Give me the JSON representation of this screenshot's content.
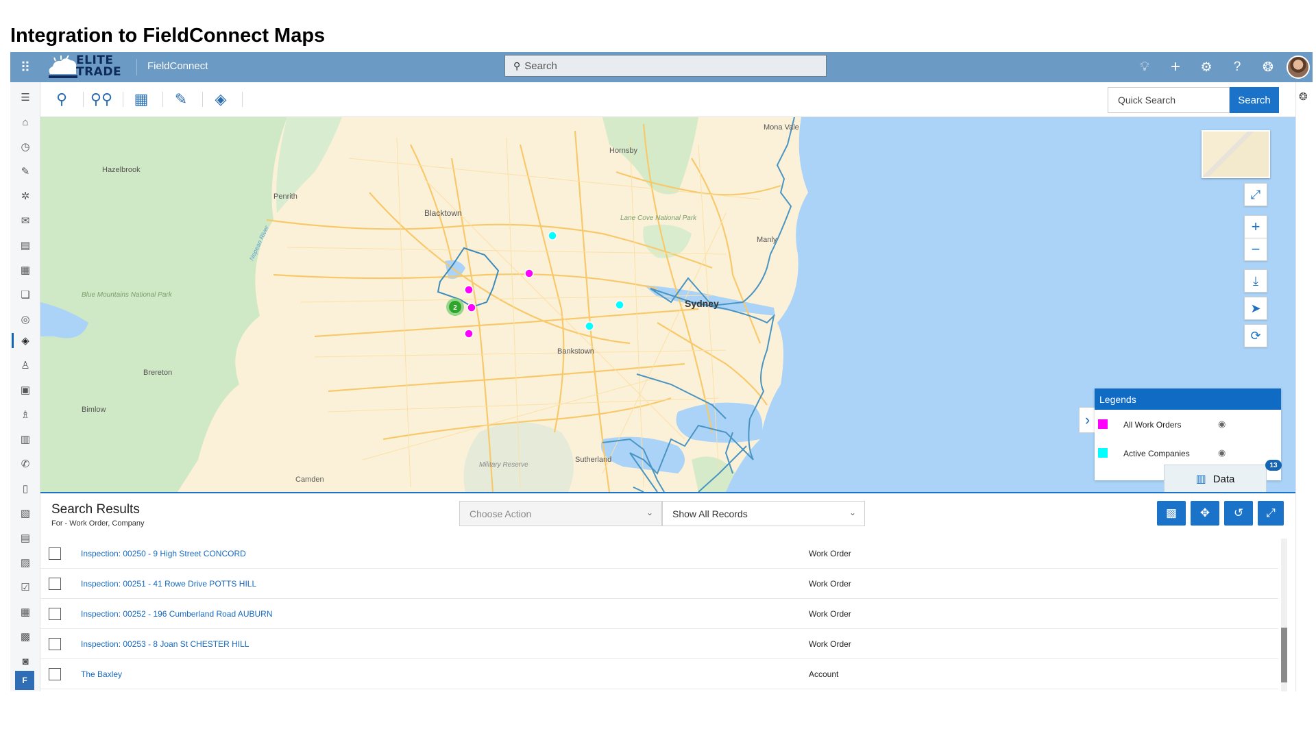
{
  "page_heading": "Integration to FieldConnect Maps",
  "topbar": {
    "brand_line1": "ELITE",
    "brand_line2": "TRADE",
    "app_name": "FieldConnect",
    "search_placeholder": "Search",
    "icons": [
      "app-launcher-icon",
      "lightbulb-icon",
      "plus-icon",
      "gear-icon",
      "help-icon",
      "copilot-icon"
    ]
  },
  "toolbar": {
    "tools": [
      "search-icon",
      "route-pins-icon",
      "calendar-icon",
      "ruler-icon",
      "layers-icon"
    ],
    "quick_search_placeholder": "Quick Search",
    "search_button": "Search"
  },
  "map": {
    "place_labels": [
      "Hazelbrook",
      "Penrith",
      "Blacktown",
      "Hornsby",
      "Mona Vale",
      "Lane Cove National Park",
      "Manly",
      "Sydney",
      "Bankstown",
      "Brereton",
      "Bimlow",
      "Blue Mountains National Park",
      "Camden",
      "Sutherland",
      "Military Reserve",
      "Nepean River"
    ],
    "cluster_count": "2",
    "legend": {
      "title": "Legends",
      "items": [
        {
          "label": "All Work Orders",
          "color": "#ff00ff"
        },
        {
          "label": "Active Companies",
          "color": "#00ffff"
        }
      ]
    },
    "data_button": "Data",
    "data_count": "13"
  },
  "results": {
    "title": "Search Results",
    "subtitle": "For - Work Order, Company",
    "action_placeholder": "Choose Action",
    "filter_value": "Show All Records",
    "rows": [
      {
        "name": "Inspection: 00250 - 9 High Street CONCORD",
        "type": "Work Order"
      },
      {
        "name": "Inspection: 00251 - 41 Rowe Drive POTTS HILL",
        "type": "Work Order"
      },
      {
        "name": "Inspection: 00252 - 196 Cumberland Road AUBURN",
        "type": "Work Order"
      },
      {
        "name": "Inspection: 00253 - 8 Joan St CHESTER HILL",
        "type": "Work Order"
      },
      {
        "name": "The Baxley",
        "type": "Account"
      }
    ]
  },
  "user_initial": "F",
  "colors": {
    "topbar": "#6b9ac4",
    "accent": "#1a73c9",
    "water": "#aad3f7",
    "park": "#cfe8c5"
  }
}
